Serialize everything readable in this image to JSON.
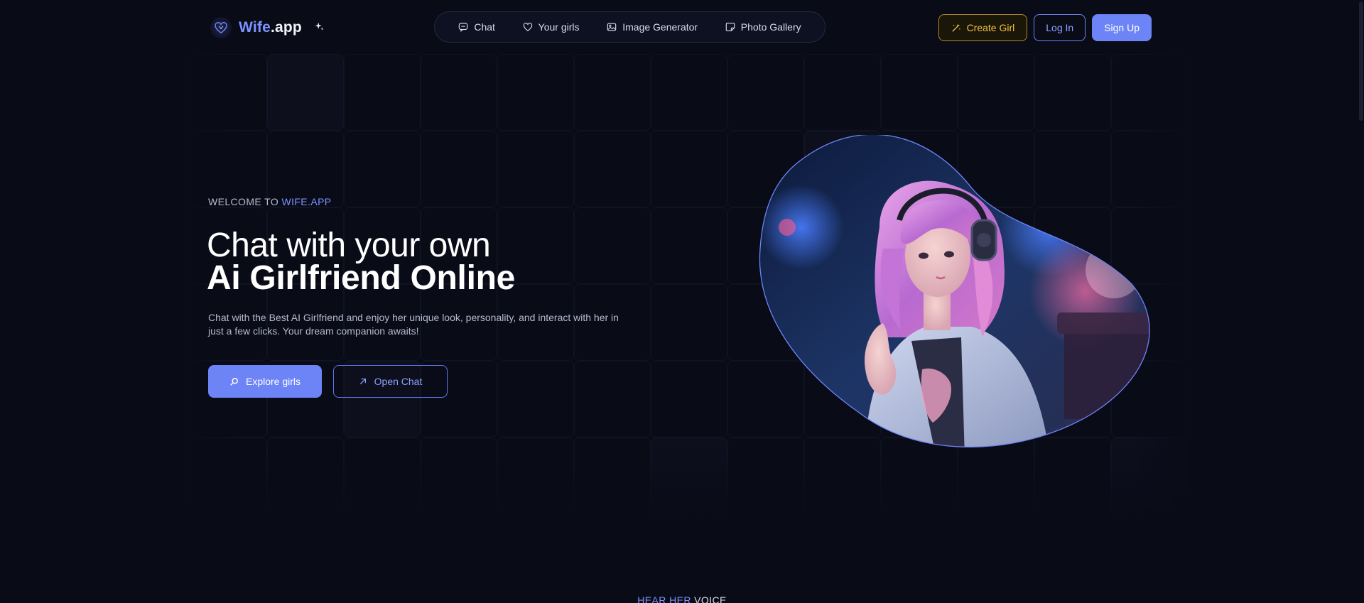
{
  "brand": {
    "name_part1": "Wife",
    "name_part2": ".app"
  },
  "nav": {
    "items": [
      {
        "label": "Chat",
        "icon": "chat-bubble-icon"
      },
      {
        "label": "Your girls",
        "icon": "heart-icon"
      },
      {
        "label": "Image Generator",
        "icon": "image-icon"
      },
      {
        "label": "Photo Gallery",
        "icon": "gallery-icon"
      }
    ]
  },
  "actions": {
    "create_label": "Create Girl",
    "login_label": "Log In",
    "signup_label": "Sign Up"
  },
  "hero": {
    "eyebrow_prefix": "WELCOME TO ",
    "eyebrow_highlight": "WIFE.APP",
    "title_line1": "Chat with your own",
    "title_line2": "Ai Girlfriend Online",
    "description": "Chat with the Best AI Girlfriend and enjoy her unique look, personality, and interact with her in just a few clicks. Your dream companion awaits!",
    "explore_label": "Explore girls",
    "open_chat_label": "Open Chat"
  },
  "next_section": {
    "label_highlight": "HEAR HER",
    "label_rest": " VOICE"
  },
  "colors": {
    "background": "#090b17",
    "accent": "#6d84f7",
    "gold": "#f4c042"
  }
}
